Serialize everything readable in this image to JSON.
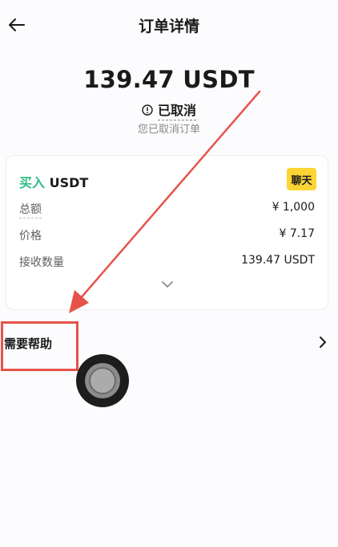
{
  "header": {
    "title": "订单详情",
    "back_icon": "arrow-left-icon"
  },
  "order": {
    "amount": "139.47 USDT",
    "status": "已取消",
    "status_icon": "info-circle-icon",
    "status_sub": "您已取消订单"
  },
  "card": {
    "side": "买入",
    "asset": "USDT",
    "chat_label": "聊天",
    "rows": [
      {
        "label": "总额",
        "value": "¥ 1,000"
      },
      {
        "label": "价格",
        "value": "¥ 7.17"
      },
      {
        "label": "接收数量",
        "value": "139.47 USDT"
      }
    ],
    "expand_icon": "chevron-down-icon"
  },
  "help": {
    "label": "需要帮助",
    "chevron_icon": "chevron-right-icon"
  },
  "colors": {
    "buy_green": "#2ebd85",
    "chat_yellow": "#fcd535",
    "annotation_red": "#e5534b"
  }
}
